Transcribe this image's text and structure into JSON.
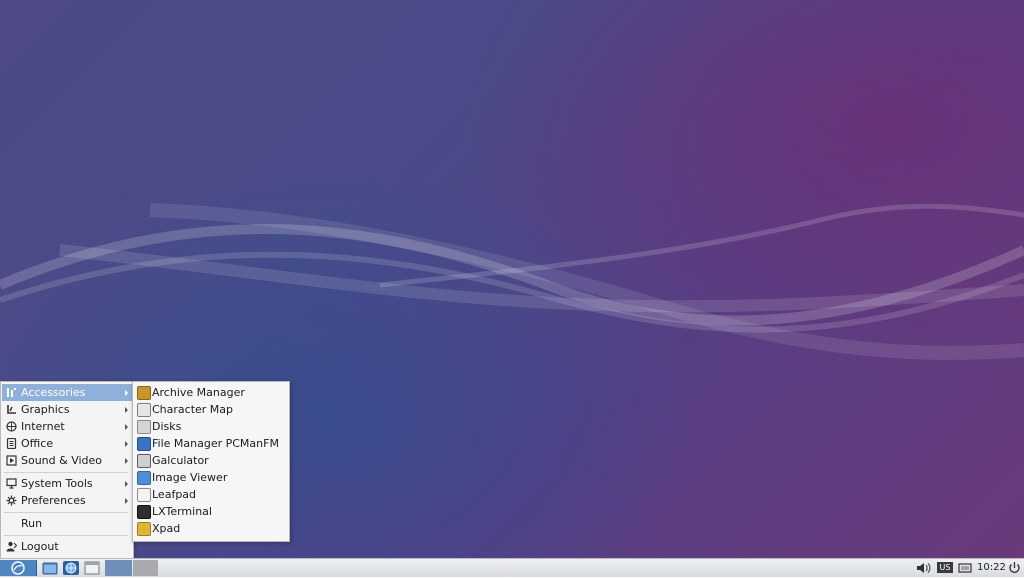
{
  "main_menu": {
    "items": [
      {
        "label": "Accessories",
        "icon": "accessories-icon",
        "submenu": true
      },
      {
        "label": "Graphics",
        "icon": "graphics-icon",
        "submenu": true
      },
      {
        "label": "Internet",
        "icon": "internet-icon",
        "submenu": true
      },
      {
        "label": "Office",
        "icon": "office-icon",
        "submenu": true
      },
      {
        "label": "Sound & Video",
        "icon": "sound-video-icon",
        "submenu": true
      },
      {
        "label": "System Tools",
        "icon": "system-tools-icon",
        "submenu": true
      },
      {
        "label": "Preferences",
        "icon": "preferences-icon",
        "submenu": true
      }
    ],
    "run_label": "Run",
    "logout_label": "Logout"
  },
  "sub_menu": {
    "items": [
      {
        "label": "Archive Manager",
        "icon": "archive-manager-icon",
        "color": "#c9952f"
      },
      {
        "label": "Character Map",
        "icon": "character-map-icon",
        "color": "#7e7e7e"
      },
      {
        "label": "Disks",
        "icon": "disks-icon",
        "color": "#9a9a9a"
      },
      {
        "label": "File Manager PCManFM",
        "icon": "file-manager-icon",
        "color": "#3b74c4"
      },
      {
        "label": "Galculator",
        "icon": "calculator-icon",
        "color": "#6d6d6d"
      },
      {
        "label": "Image Viewer",
        "icon": "image-viewer-icon",
        "color": "#4f8fd1"
      },
      {
        "label": "Leafpad",
        "icon": "leafpad-icon",
        "color": "#b9b9b9"
      },
      {
        "label": "LXTerminal",
        "icon": "terminal-icon",
        "color": "#2e2e2e"
      },
      {
        "label": "Xpad",
        "icon": "xpad-icon",
        "color": "#e0b43a"
      }
    ]
  },
  "taskbar": {
    "keyboard_layout": "US",
    "clock": "10:22"
  },
  "colors": {
    "menu_highlight": "#8fb0d9",
    "taskbar_bg": "#e2e5e8"
  }
}
